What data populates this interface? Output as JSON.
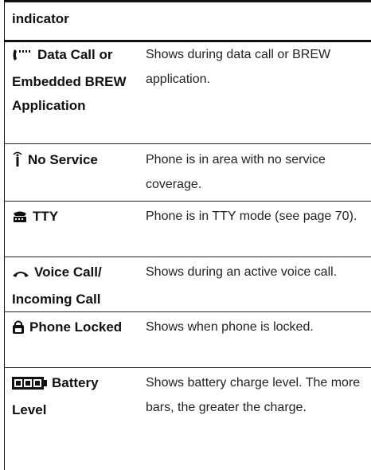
{
  "header": {
    "label": "indicator"
  },
  "rows": [
    {
      "icon": "data-call-icon",
      "name": "Data Call or Embedded BREW Application",
      "desc": "Shows during data call or BREW application."
    },
    {
      "icon": "no-service-icon",
      "name": "No Service",
      "desc": "Phone is in area with no service coverage."
    },
    {
      "icon": "tty-icon",
      "name": "TTY",
      "desc": "Phone is in TTY mode (see page 70)."
    },
    {
      "icon": "voice-call-icon",
      "name": "Voice Call/ Incoming Call",
      "desc": "Shows during an active voice call."
    },
    {
      "icon": "phone-locked-icon",
      "name": "Phone Locked",
      "desc": "Shows when phone is locked."
    },
    {
      "icon": "battery-level-icon",
      "name": "Battery Level",
      "desc": "Shows battery charge level. The more bars, the greater the charge."
    }
  ],
  "colors": {
    "text": "#111111",
    "rule": "#222222"
  }
}
